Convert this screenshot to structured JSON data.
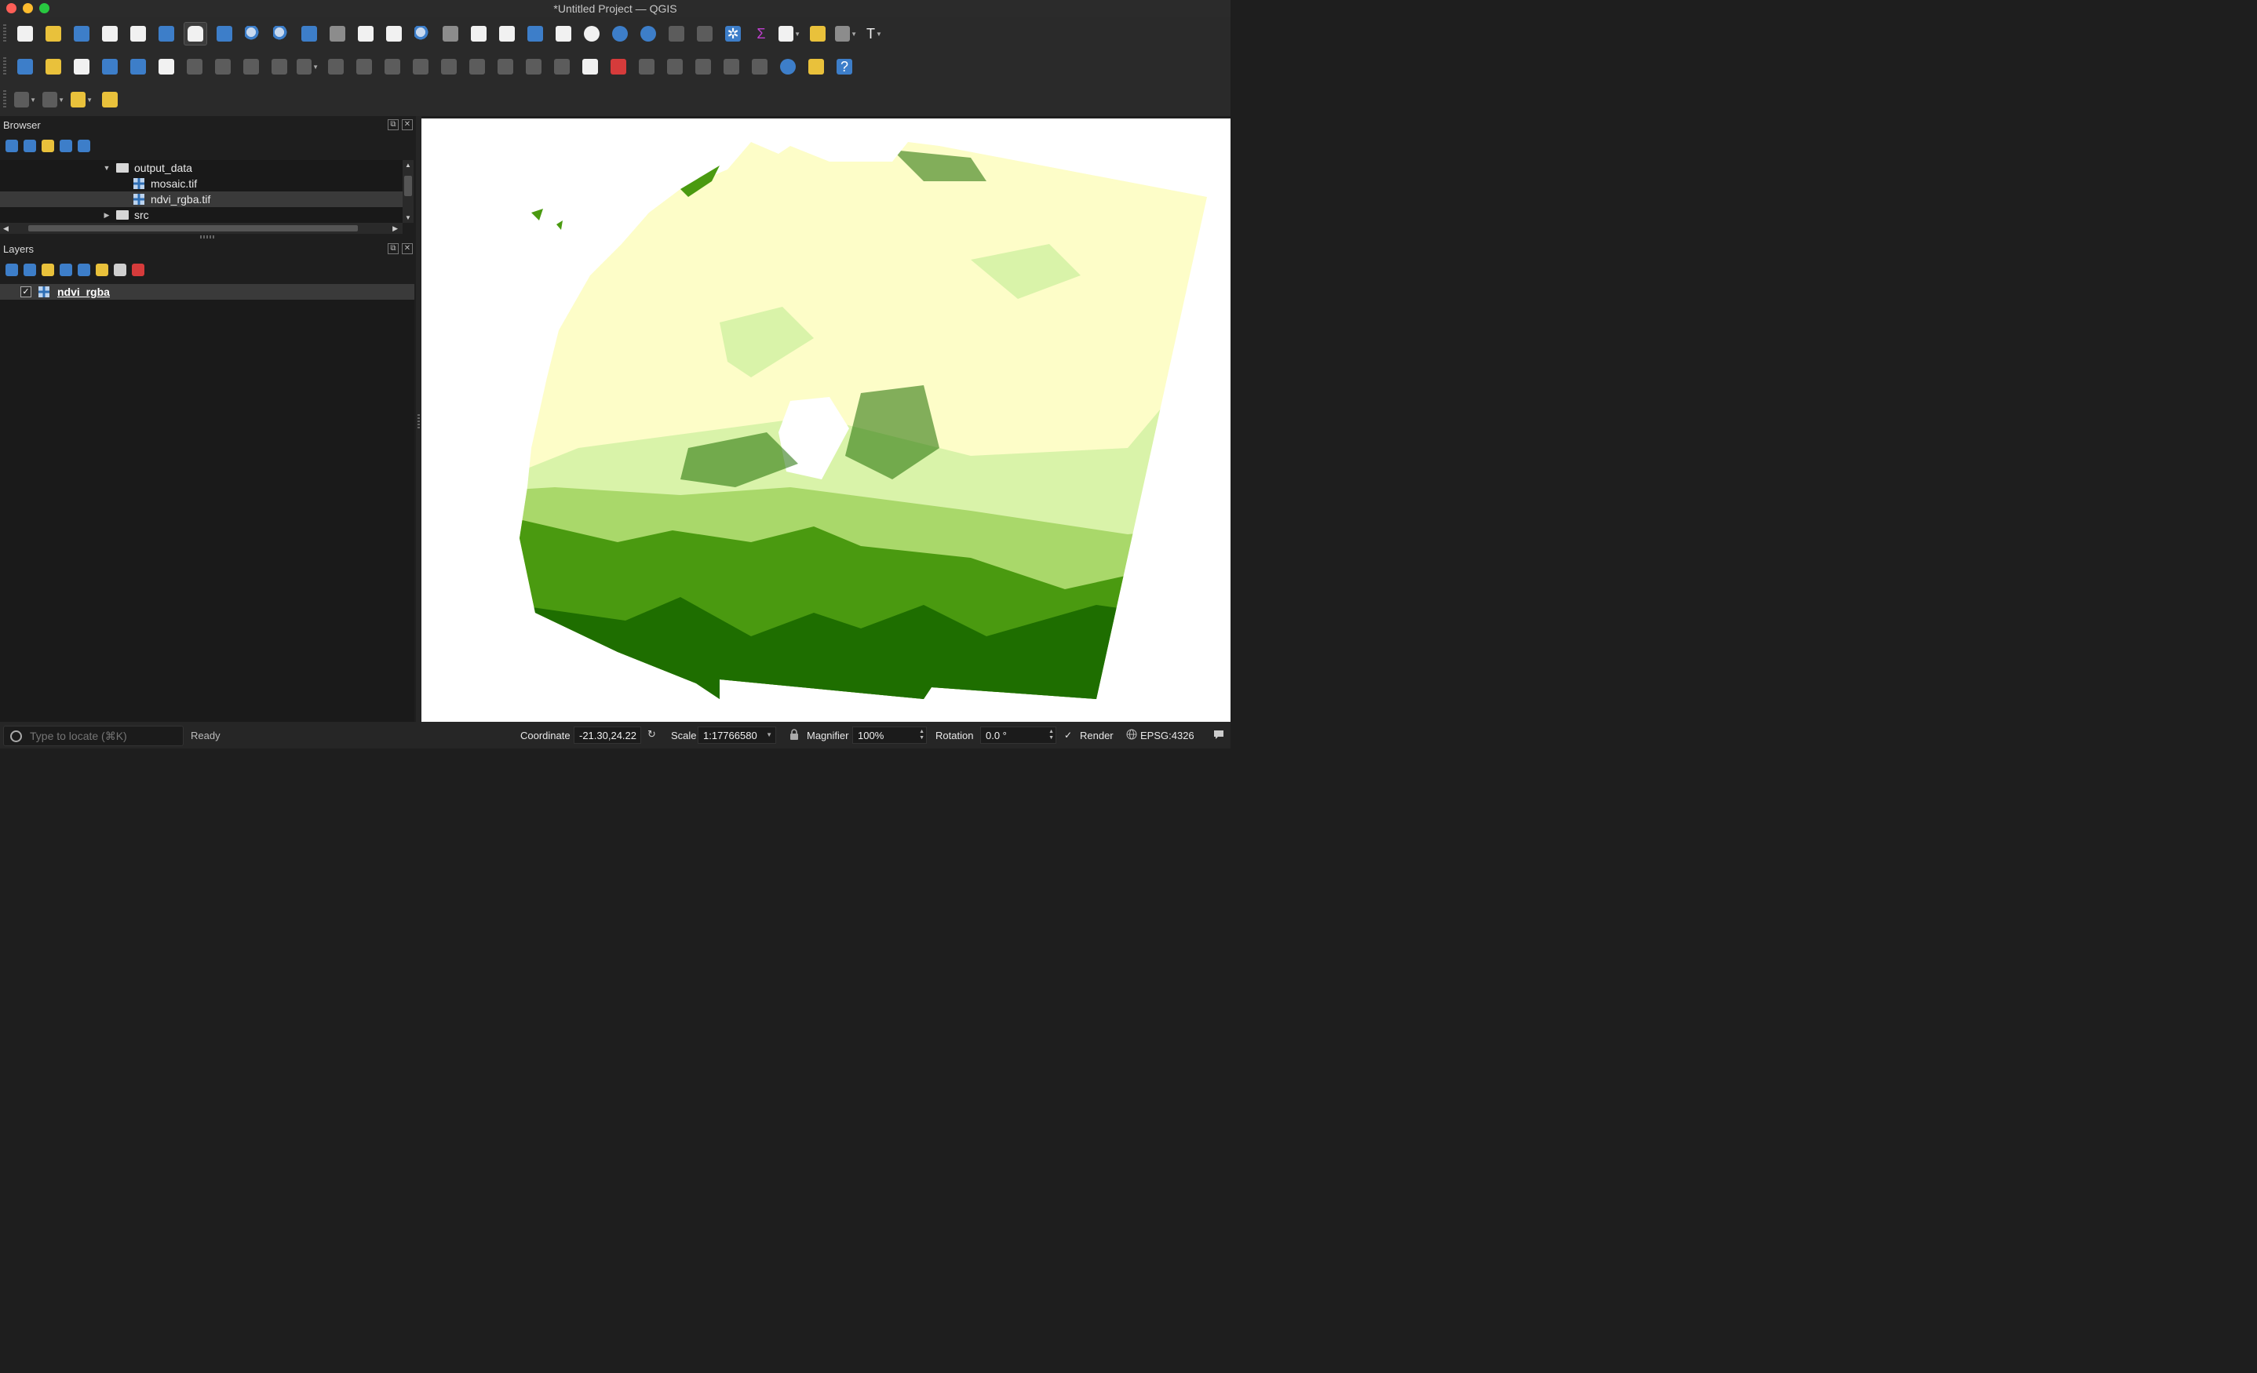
{
  "window": {
    "title": "*Untitled Project — QGIS"
  },
  "toolbar": {
    "row1": [
      {
        "name": "new-project-icon",
        "color": "white"
      },
      {
        "name": "open-project-icon",
        "color": "yellow"
      },
      {
        "name": "save-project-icon",
        "color": "blue"
      },
      {
        "name": "new-print-layout-icon",
        "color": "white"
      },
      {
        "name": "layout-manager-icon",
        "color": "white"
      },
      {
        "name": "style-manager-icon",
        "color": "blue"
      },
      {
        "name": "pan-map-icon",
        "color": "hand",
        "active": true
      },
      {
        "name": "pan-to-selection-icon",
        "color": "blue"
      },
      {
        "name": "zoom-in-icon",
        "color": "mag"
      },
      {
        "name": "zoom-out-icon",
        "color": "mag"
      },
      {
        "name": "zoom-full-icon",
        "color": "blue"
      },
      {
        "name": "zoom-to-selection-icon",
        "color": "lgrey"
      },
      {
        "name": "zoom-to-layer-icon",
        "color": "white"
      },
      {
        "name": "zoom-native-icon",
        "color": "white"
      },
      {
        "name": "zoom-last-icon",
        "color": "mag"
      },
      {
        "name": "zoom-next-icon",
        "color": "lgrey"
      },
      {
        "name": "new-map-view-icon",
        "color": "white"
      },
      {
        "name": "new-3d-map-view-icon",
        "color": "white"
      },
      {
        "name": "new-bookmark-icon",
        "color": "blue"
      },
      {
        "name": "show-bookmarks-icon",
        "color": "white"
      },
      {
        "name": "temporal-controller-icon",
        "color": "white",
        "round": true
      },
      {
        "name": "refresh-icon",
        "color": "blue",
        "round": true
      },
      {
        "name": "identify-features-icon",
        "color": "blue",
        "round": true
      },
      {
        "name": "attribute-table-icon",
        "color": "grey"
      },
      {
        "name": "statistical-summary-icon",
        "color": "grey"
      },
      {
        "name": "field-calculator-icon",
        "color": "blue",
        "glyph": "✲"
      },
      {
        "name": "sum-icon",
        "color": "none",
        "glyph": "Σ",
        "glyphColor": "#c040d0"
      },
      {
        "name": "measure-line-icon",
        "color": "white",
        "dropdown": true
      },
      {
        "name": "map-tips-icon",
        "color": "yellow"
      },
      {
        "name": "settings-icon",
        "color": "lgrey",
        "dropdown": true
      },
      {
        "name": "text-annotation-icon",
        "color": "none",
        "glyph": "T",
        "glyphColor": "#f1f1f1",
        "dropdown": true
      }
    ],
    "row2": [
      {
        "name": "data-source-manager-icon",
        "color": "blue"
      },
      {
        "name": "new-geopackage-layer-icon",
        "color": "yellow"
      },
      {
        "name": "new-shapefile-layer-icon",
        "color": "white"
      },
      {
        "name": "new-spatialite-layer-icon",
        "color": "blue"
      },
      {
        "name": "new-virtual-layer-icon",
        "color": "blue"
      },
      {
        "name": "new-temporary-layer-icon",
        "color": "white"
      },
      {
        "name": "current-edits-icon",
        "color": "grey"
      },
      {
        "name": "toggle-editing-icon",
        "color": "grey"
      },
      {
        "name": "save-edits-icon",
        "color": "grey"
      },
      {
        "name": "add-point-feature-icon",
        "color": "grey"
      },
      {
        "name": "vertex-tool-icon",
        "color": "grey",
        "dropdown": true
      },
      {
        "name": "modify-attributes-icon",
        "color": "grey"
      },
      {
        "name": "delete-selected-icon",
        "color": "grey"
      },
      {
        "name": "cut-features-icon",
        "color": "grey"
      },
      {
        "name": "copy-features-icon",
        "color": "grey"
      },
      {
        "name": "paste-features-icon",
        "color": "grey"
      },
      {
        "name": "undo-icon",
        "color": "grey"
      },
      {
        "name": "redo-icon",
        "color": "grey"
      },
      {
        "name": "label-toolbar-icon",
        "color": "grey"
      },
      {
        "name": "pin-labels-icon",
        "color": "grey"
      },
      {
        "name": "layer-labeling-options-icon",
        "color": "white"
      },
      {
        "name": "layer-diagram-options-icon",
        "color": "red"
      },
      {
        "name": "highlight-pinned-labels-icon",
        "color": "grey"
      },
      {
        "name": "show-hide-labels-icon",
        "color": "grey"
      },
      {
        "name": "move-label-icon",
        "color": "grey"
      },
      {
        "name": "rotate-label-icon",
        "color": "grey"
      },
      {
        "name": "change-label-icon",
        "color": "grey"
      },
      {
        "name": "metasearch-icon",
        "color": "blue",
        "round": true
      },
      {
        "name": "python-console-icon",
        "color": "yellow"
      },
      {
        "name": "help-icon",
        "color": "blue",
        "glyph": "?",
        "glyphColor": "#ffffff"
      }
    ],
    "row3": [
      {
        "name": "select-features-icon",
        "color": "grey",
        "dropdown": true
      },
      {
        "name": "select-by-value-icon",
        "color": "grey",
        "dropdown": true
      },
      {
        "name": "deselect-features-icon",
        "color": "yellow",
        "dropdown": true
      },
      {
        "name": "identify-results-icon",
        "color": "yellow"
      }
    ]
  },
  "browser": {
    "title": "Browser",
    "tools": [
      "add-selected-layers-icon",
      "refresh-icon",
      "filter-icon",
      "collapse-all-icon",
      "info-icon"
    ],
    "items": [
      {
        "label": "output_data",
        "type": "folder",
        "expanded": true,
        "indent": 0
      },
      {
        "label": "mosaic.tif",
        "type": "raster",
        "indent": 1
      },
      {
        "label": "ndvi_rgba.tif",
        "type": "raster",
        "indent": 1,
        "selected": true
      },
      {
        "label": "src",
        "type": "folder",
        "expanded": false,
        "indent": 0
      }
    ]
  },
  "layers": {
    "title": "Layers",
    "tools": [
      "open-layer-styling-icon",
      "add-group-icon",
      "manage-visibility-icon",
      "filter-legend-icon",
      "filter-by-expression-icon",
      "expand-all-icon",
      "collapse-all-icon",
      "remove-layer-icon"
    ],
    "items": [
      {
        "label": "ndvi_rgba",
        "checked": true,
        "check_mark": "✓"
      }
    ]
  },
  "map": {
    "colors": {
      "desert": "#fdfdc8",
      "sparse": "#d9f3a9",
      "moderate": "#a9d86a",
      "dense": "#4a9a10",
      "very_dense": "#1e6e00",
      "water_nodata": "#ffffff"
    }
  },
  "statusbar": {
    "locator_placeholder": "Type to locate (⌘K)",
    "status": "Ready",
    "coordinate_label": "Coordinate",
    "coordinate_value": "-21.30,24.22",
    "scale_label": "Scale",
    "scale_value": "1:17766580",
    "magnifier_label": "Magnifier",
    "magnifier_value": "100%",
    "rotation_label": "Rotation",
    "rotation_value": "0.0 °",
    "render_label": "Render",
    "render_checked": true,
    "render_check_mark": "✓",
    "crs": "EPSG:4326"
  }
}
